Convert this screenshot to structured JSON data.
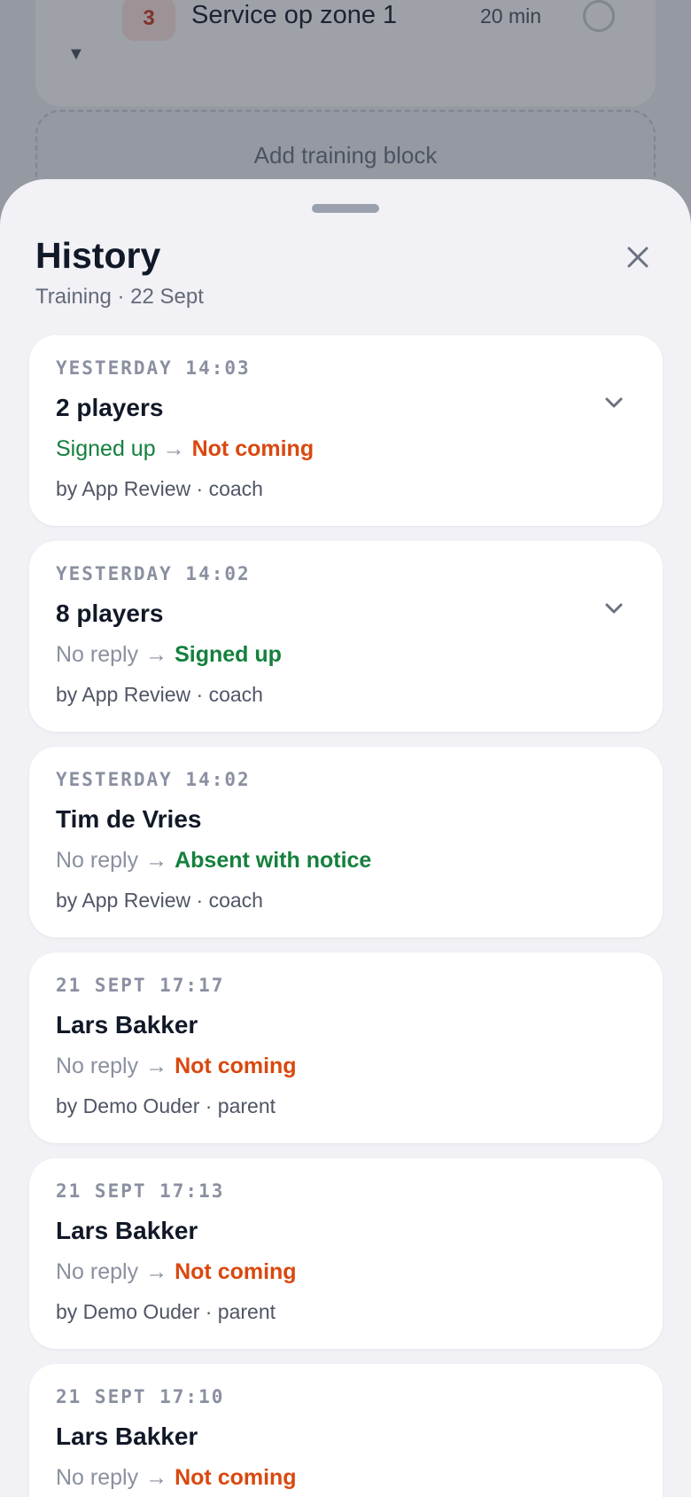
{
  "background": {
    "block_number": "3",
    "block_title": "Service op zone 1",
    "block_duration": "20 min",
    "caret_icon": "triangle-down-icon",
    "add_block_label": "Add training block"
  },
  "sheet": {
    "title": "History",
    "subtitle": "Training · 22 Sept",
    "close_icon": "close-icon"
  },
  "colors": {
    "green": "#15803d",
    "orange": "#d9480f",
    "muted": "#8a90a0"
  },
  "entries": [
    {
      "time": "YESTERDAY 14:03",
      "subject": "2 players",
      "from": "Signed up",
      "from_color": "#15803d",
      "to": "Not coming",
      "to_color": "#d9480f",
      "by": "by App Review · coach",
      "expandable": true
    },
    {
      "time": "YESTERDAY 14:02",
      "subject": "8 players",
      "from": "No reply",
      "from_color": "#8a90a0",
      "to": "Signed up",
      "to_color": "#15803d",
      "by": "by App Review · coach",
      "expandable": true
    },
    {
      "time": "YESTERDAY 14:02",
      "subject": "Tim de Vries",
      "from": "No reply",
      "from_color": "#8a90a0",
      "to": "Absent with notice",
      "to_color": "#15803d",
      "by": "by App Review · coach",
      "expandable": false
    },
    {
      "time": "21 SEPT 17:17",
      "subject": "Lars Bakker",
      "from": "No reply",
      "from_color": "#8a90a0",
      "to": "Not coming",
      "to_color": "#d9480f",
      "by": "by Demo Ouder · parent",
      "expandable": false
    },
    {
      "time": "21 SEPT 17:13",
      "subject": "Lars Bakker",
      "from": "No reply",
      "from_color": "#8a90a0",
      "to": "Not coming",
      "to_color": "#d9480f",
      "by": "by Demo Ouder · parent",
      "expandable": false
    },
    {
      "time": "21 SEPT 17:10",
      "subject": "Lars Bakker",
      "from": "No reply",
      "from_color": "#8a90a0",
      "to": "Not coming",
      "to_color": "#d9480f",
      "by": "",
      "expandable": false
    }
  ]
}
